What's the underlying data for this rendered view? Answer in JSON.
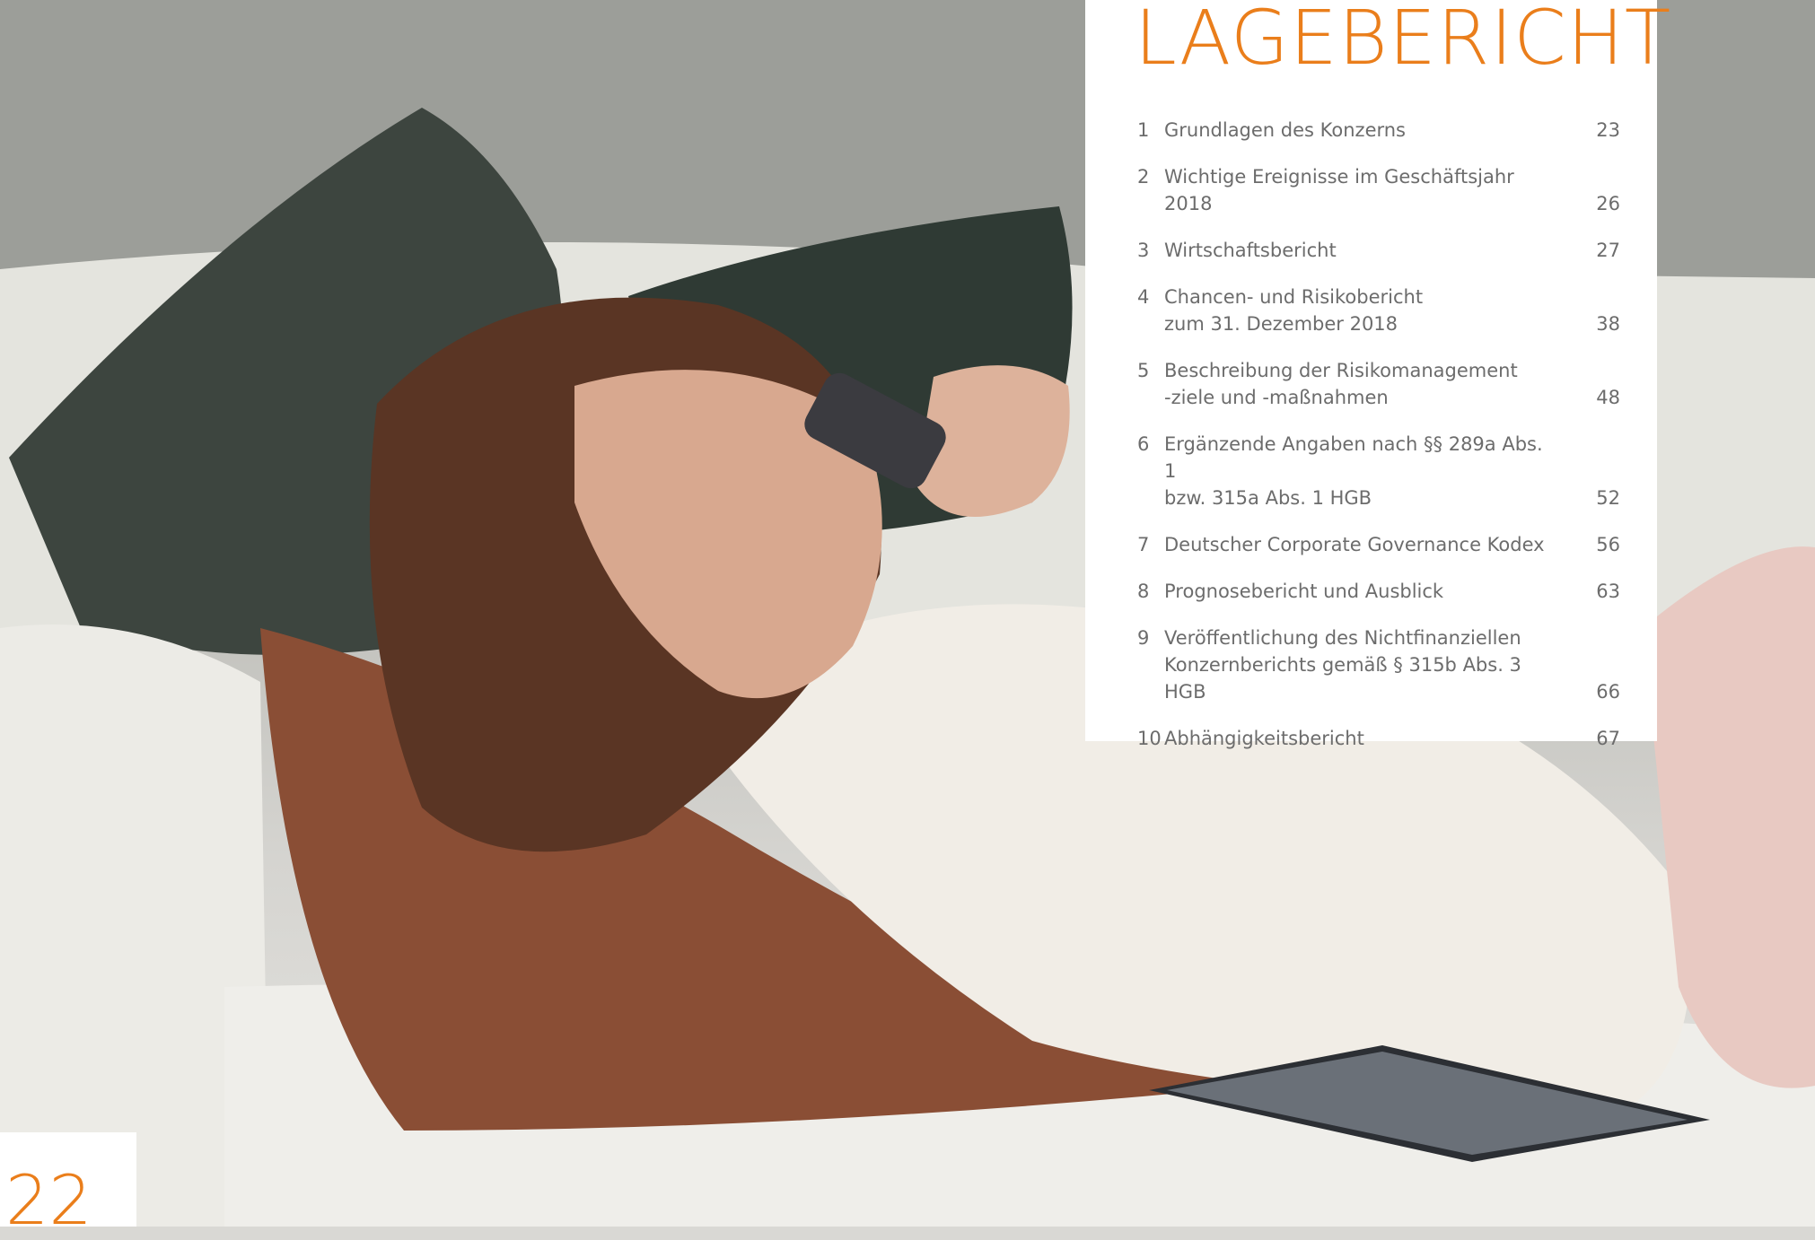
{
  "toc": {
    "title": "LAGEBERICHT",
    "items": [
      {
        "num": "1",
        "line1": "Grundlagen des Konzerns",
        "line2": "",
        "page": "23"
      },
      {
        "num": "2",
        "line1": "Wichtige Ereignisse im Geschäftsjahr 2018",
        "line2": "",
        "page": "26"
      },
      {
        "num": "3",
        "line1": "Wirtschaftsbericht",
        "line2": "",
        "page": "27"
      },
      {
        "num": "4",
        "line1": "Chancen- und Risikobericht",
        "line2": "zum 31. Dezember 2018",
        "page": "38"
      },
      {
        "num": "5",
        "line1": "Beschreibung der Risikomanagement",
        "line2": "-ziele und -maßnahmen",
        "page": "48"
      },
      {
        "num": "6",
        "line1": "Ergänzende Angaben nach §§ 289a Abs. 1",
        "line2": "bzw. 315a Abs. 1 HGB",
        "page": "52"
      },
      {
        "num": "7",
        "line1": "Deutscher Corporate Governance Kodex",
        "line2": "",
        "page": "56"
      },
      {
        "num": "8",
        "line1": "Prognosebericht und Ausblick",
        "line2": "",
        "page": "63"
      },
      {
        "num": "9",
        "line1": "Veröffentlichung des Nichtfinanziellen",
        "line2": "Konzernberichts gemäß § 315b Abs. 3 HGB",
        "page": "66"
      },
      {
        "num": "10",
        "line1": "Abhängigkeitsbericht",
        "line2": "",
        "page": "67"
      }
    ]
  },
  "page_number": "22",
  "colors": {
    "accent": "#ea7e1b",
    "text": "#6c6c6c",
    "panel": "#ffffff"
  }
}
